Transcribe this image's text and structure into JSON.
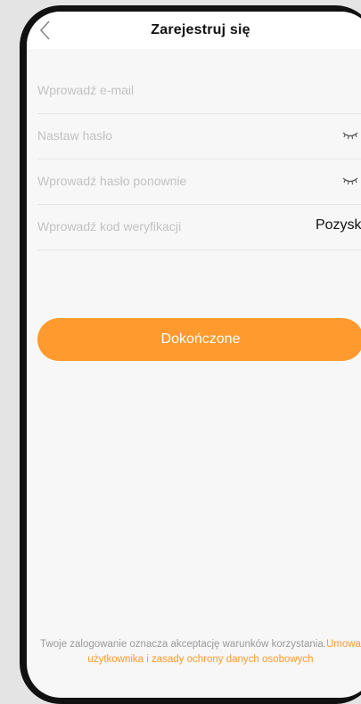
{
  "header": {
    "title": "Zarejestruj się",
    "back_icon": "chevron-left-icon"
  },
  "form": {
    "email_placeholder": "Wprowadź e-mail",
    "email_value": "",
    "password_placeholder": "Nastaw hasło",
    "password_value": "",
    "confirm_password_placeholder": "Wprowadź hasło ponownie",
    "confirm_password_value": "",
    "code_placeholder": "Wprowadź kod weryfikacji",
    "code_value": "",
    "get_code_label": "Pozyskaj",
    "eye_icon": "eye-closed-icon"
  },
  "submit_label": "Dokończone",
  "terms": {
    "prefix": "Twoje zalogowanie oznacza akceptację warunków korzystania.",
    "link": "Umowa użytkownika i zasady ochrony danych osobowych"
  },
  "colors": {
    "accent": "#ff9a2e",
    "background": "#f7f7f7",
    "frame": "#111111"
  }
}
